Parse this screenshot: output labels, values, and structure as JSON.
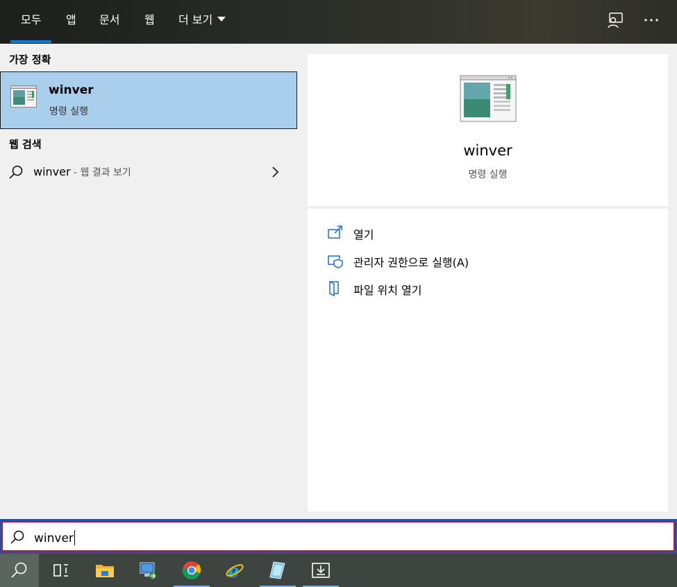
{
  "tabs": [
    {
      "label": "모두",
      "active": true
    },
    {
      "label": "앱"
    },
    {
      "label": "문서"
    },
    {
      "label": "웹"
    },
    {
      "label": "더 보기"
    }
  ],
  "top_icons": [
    "feedback-icon",
    "more-options-icon"
  ],
  "best_match": {
    "section": "가장 정확",
    "title": "winver",
    "subtitle": "명령 실행"
  },
  "web_search": {
    "section": "웹 검색",
    "query": "winver",
    "suffix": " - 웹 결과 보기"
  },
  "detail": {
    "title": "winver",
    "subtitle": "명령 실행",
    "actions": [
      {
        "label": "열기",
        "icon": "open-icon"
      },
      {
        "label": "관리자 권한으로 실행(A)",
        "icon": "run-as-admin-icon"
      },
      {
        "label": "파일 위치 열기",
        "icon": "open-file-location-icon"
      }
    ]
  },
  "search": {
    "value": "winver"
  },
  "taskbar": [
    "search-icon",
    "task-view-icon",
    "file-explorer-icon",
    "network-icon",
    "chrome-icon",
    "internet-explorer-icon",
    "notepad-icon",
    "download-icon"
  ],
  "colors": {
    "accent": "#0f78d4",
    "selection": "#aacfed",
    "search_border": "#c8102e"
  }
}
